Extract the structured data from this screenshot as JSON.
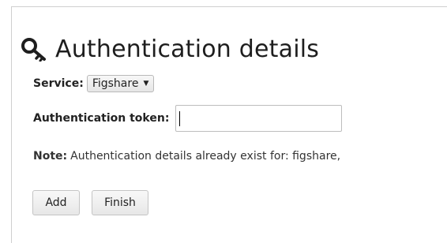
{
  "header": {
    "icon": "key-icon",
    "title": "Authentication details"
  },
  "service": {
    "label": "Service:",
    "selected": "Figshare",
    "caret": "▼"
  },
  "token": {
    "label": "Authentication token:",
    "value": ""
  },
  "note": {
    "label": "Note:",
    "text": "Authentication details already exist for: figshare,"
  },
  "buttons": {
    "add": "Add",
    "finish": "Finish"
  }
}
